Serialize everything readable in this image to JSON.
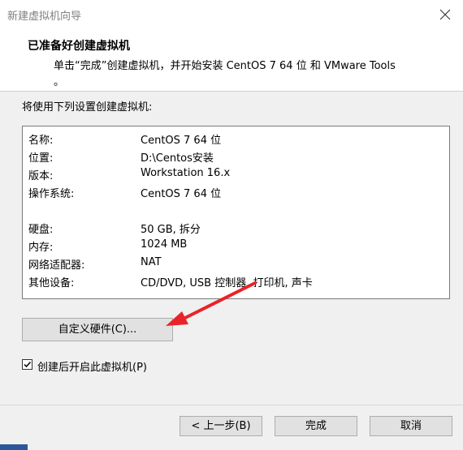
{
  "window": {
    "title": "新建虚拟机向导"
  },
  "header": {
    "title": "已准备好创建虚拟机",
    "description": "单击“完成”创建虚拟机，并开始安装 CentOS 7 64 位 和 VMware Tools",
    "description_tail": "。"
  },
  "intro": "将使用下列设置创建虚拟机:",
  "summary": [
    {
      "key": "名称:",
      "value": "CentOS 7 64 位"
    },
    {
      "key": "位置:",
      "value": "D:\\Centos安装"
    },
    {
      "key": "版本:",
      "value": "Workstation 16.x"
    },
    {
      "key": "操作系统:",
      "value": "CentOS 7 64 位"
    },
    {
      "key": "硬盘:",
      "value": "50 GB, 拆分"
    },
    {
      "key": "内存:",
      "value": "1024 MB"
    },
    {
      "key": "网络适配器:",
      "value": "NAT"
    },
    {
      "key": "其他设备:",
      "value": "CD/DVD, USB 控制器, 打印机, 声卡"
    }
  ],
  "customize_button": "自定义硬件(C)...",
  "power_on": {
    "label": "创建后开启此虚拟机(P)",
    "checked": true
  },
  "buttons": {
    "back": "< 上一步(B)",
    "finish": "完成",
    "cancel": "取消"
  },
  "colors": {
    "annotation_arrow": "#e8242a"
  }
}
